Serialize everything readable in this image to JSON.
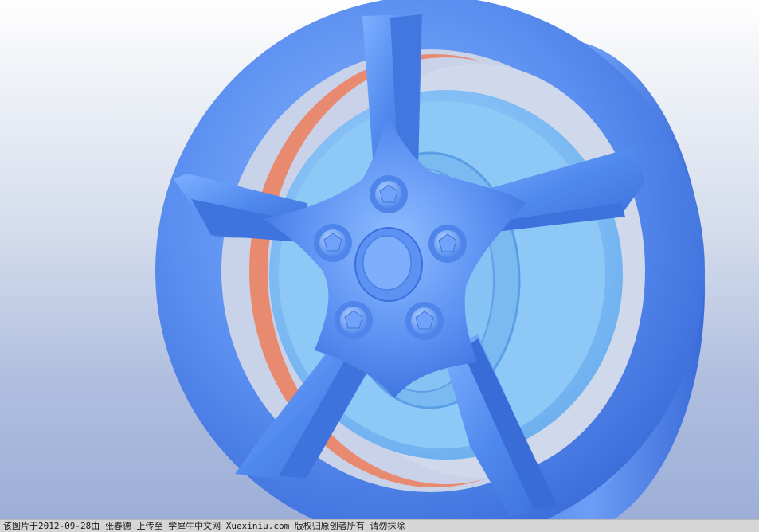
{
  "viewport": {
    "model": "wheel-rim",
    "colors": {
      "model_blue": "#5a8ff0",
      "model_highlight": "#9cc4ff",
      "model_shadow": "#2d5fcc",
      "hub_blue": "#86c2f5",
      "inner_barrel": "#e88a70"
    }
  },
  "watermark": {
    "text": "该图片于2012-09-28由 张春德 上传至 学犀牛中文网 Xuexiniu.com 版权归原创者所有 请勿抹除"
  }
}
